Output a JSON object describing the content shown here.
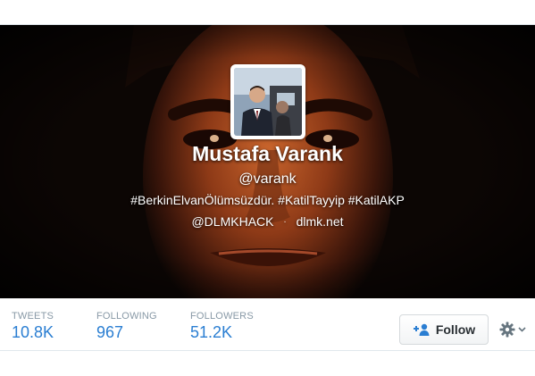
{
  "profile": {
    "name": "Mustafa Varank",
    "handle": "@varank",
    "bio": "#BerkinElvanÖlümsüzdür. #KatilTayyip #KatilAKP",
    "mention": "@DLMKHACK",
    "separator": "·",
    "website": "dlmk.net"
  },
  "stats": [
    {
      "label": "TWEETS",
      "value": "10.8K"
    },
    {
      "label": "FOLLOWING",
      "value": "967"
    },
    {
      "label": "FOLLOWERS",
      "value": "51.2K"
    }
  ],
  "actions": {
    "follow_label": "Follow",
    "follow_icon": "person-plus-icon",
    "settings_icon": "gear-icon"
  },
  "colors": {
    "link": "#2a7ed2",
    "label": "#8899a6",
    "header_bg": "#0c0604"
  }
}
